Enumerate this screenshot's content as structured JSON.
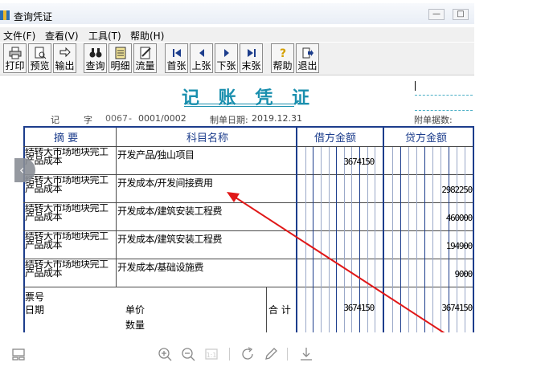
{
  "window": {
    "title": "查询凭证",
    "min_label": "—",
    "max_label": "□"
  },
  "menu": [
    "文件(F)",
    "查看(V)",
    "工具(T)",
    "帮助(H)"
  ],
  "toolbar": [
    {
      "label": "打印",
      "icon": "printer-icon"
    },
    {
      "label": "预览",
      "icon": "preview-icon"
    },
    {
      "label": "输出",
      "icon": "export-icon"
    },
    {
      "label": "查询",
      "icon": "binoculars-icon"
    },
    {
      "label": "明细",
      "icon": "detail-icon"
    },
    {
      "label": "流量",
      "icon": "flow-icon"
    },
    {
      "label": "首张",
      "icon": "first-icon"
    },
    {
      "label": "上张",
      "icon": "prev-icon"
    },
    {
      "label": "下张",
      "icon": "next-icon"
    },
    {
      "label": "末张",
      "icon": "last-icon"
    },
    {
      "label": "帮助",
      "icon": "help-icon"
    },
    {
      "label": "退出",
      "icon": "exit-icon"
    }
  ],
  "voucher": {
    "title": "记 账 凭 证",
    "type_label": "记",
    "word_label": "字",
    "number": "0067",
    "number_sep": "-",
    "page": "0001/0002",
    "date_label": "制单日期:",
    "date": "2019.12.31",
    "attach_label": "附单据数:"
  },
  "table": {
    "headers": {
      "summary": "摘 要",
      "account": "科目名称",
      "debit": "借方金额",
      "credit": "贷方金额"
    },
    "rows": [
      {
        "summary": "结转大市场地块完工产品成本",
        "account": "开发产品/独山项目",
        "debit": "3674150",
        "credit": ""
      },
      {
        "summary": "结转大市场地块完工产品成本",
        "account": "开发成本/开发间接费用",
        "debit": "",
        "credit": "2982250"
      },
      {
        "summary": "结转大市场地块完工产品成本",
        "account": "开发成本/建筑安装工程费",
        "debit": "",
        "credit": "460000"
      },
      {
        "summary": "结转大市场地块完工产品成本",
        "account": "开发成本/建筑安装工程费",
        "debit": "",
        "credit": "194900"
      },
      {
        "summary": "结转大市场地块完工产品成本",
        "account": "开发成本/基础设施费",
        "debit": "",
        "credit": "9000"
      }
    ],
    "footer": {
      "ticket_label": "票号",
      "date_label": "日期",
      "price_label": "单价",
      "qty_label": "数量",
      "total_label": "合 计",
      "total_debit": "3674150",
      "total_credit": "3674150"
    }
  },
  "colors": {
    "title": "#1a8fae",
    "border": "#1c3d8c",
    "arrow": "#e01818"
  },
  "viewer": [
    "grid-icon",
    "zoom-in-icon",
    "zoom-out-icon",
    "fit-icon",
    "rotate-icon",
    "edit-icon",
    "download-icon"
  ]
}
